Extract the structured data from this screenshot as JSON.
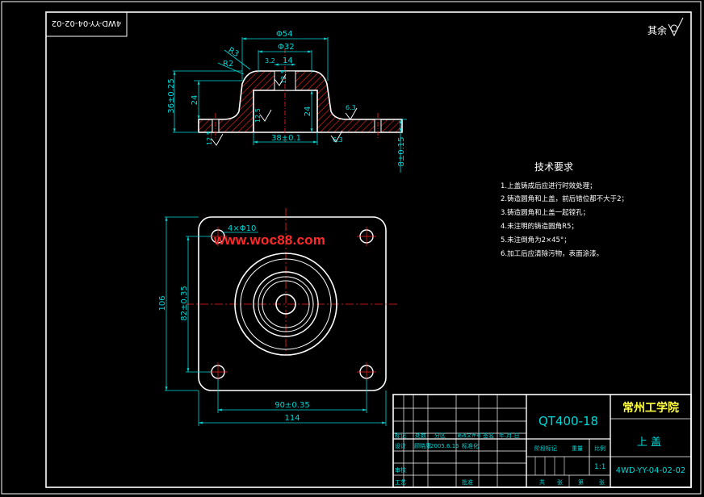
{
  "colors": {
    "background": "#000000",
    "outline": "#ffffff",
    "dimension": "#00d8d8",
    "center_line": "#ff2020",
    "hatch": "#ff2020",
    "title_text": "#00d8d8",
    "watermark": "#ff2a2a",
    "school_text": "#ffff40"
  },
  "stamp_top_left": "4WD-YY-04-02-02",
  "roughness_note": "其余",
  "watermark": "www.woc88.com",
  "section_view": {
    "dims": {
      "d54": "Φ54",
      "d32": "Φ32",
      "w14": "14",
      "r3": "R3",
      "r2": "R2",
      "ra_top": "3.2",
      "h36": "36±0.25",
      "h24_left": "24",
      "h24_inner": "24",
      "w38": "38±0.1",
      "h8": "8±0.15",
      "ra_side": "6.3",
      "ra_a": "12.5",
      "ra_b": "12.5",
      "ra_c": "6.3",
      "ra_d": "12.5"
    }
  },
  "plan_view": {
    "dims": {
      "holes": "4×Φ10",
      "h106": "106",
      "h82": "82±0.35",
      "w90": "90±0.35",
      "w114": "114"
    }
  },
  "tech_requirements": {
    "title": "技术要求",
    "items": [
      "1.上盖铸成后应进行时效处理；",
      "2.铸造圆角和上盖，前后错位都不大于2；",
      "3.铸造圆角和上盖一起镗孔；",
      "4.未注明的铸造圆角R5；",
      "5.未注倒角为2×45°；",
      "6.加工后应清除污物，表面涂漆。"
    ]
  },
  "title_block": {
    "material": "QT400-18",
    "school": "常州工学院",
    "part_name": "上  盖",
    "drawing_no": "4WD-YY-04-02-02",
    "scale_value": "1:1",
    "labels": {
      "mark": "标记",
      "count": "处数",
      "zone": "分区",
      "change_doc": "更改文件号",
      "sign": "签名",
      "date": "年.月.日",
      "design": "设计",
      "designer": "顾晓康",
      "design_date": "2005.6.15",
      "standard": "标准化",
      "stage_mark": "阶段标记",
      "weight": "重量",
      "scale": "比例",
      "review": "审核",
      "process": "工艺",
      "approve": "批准",
      "sheet_total": "共",
      "sheet_word": "张",
      "sheet_no": "第"
    }
  }
}
